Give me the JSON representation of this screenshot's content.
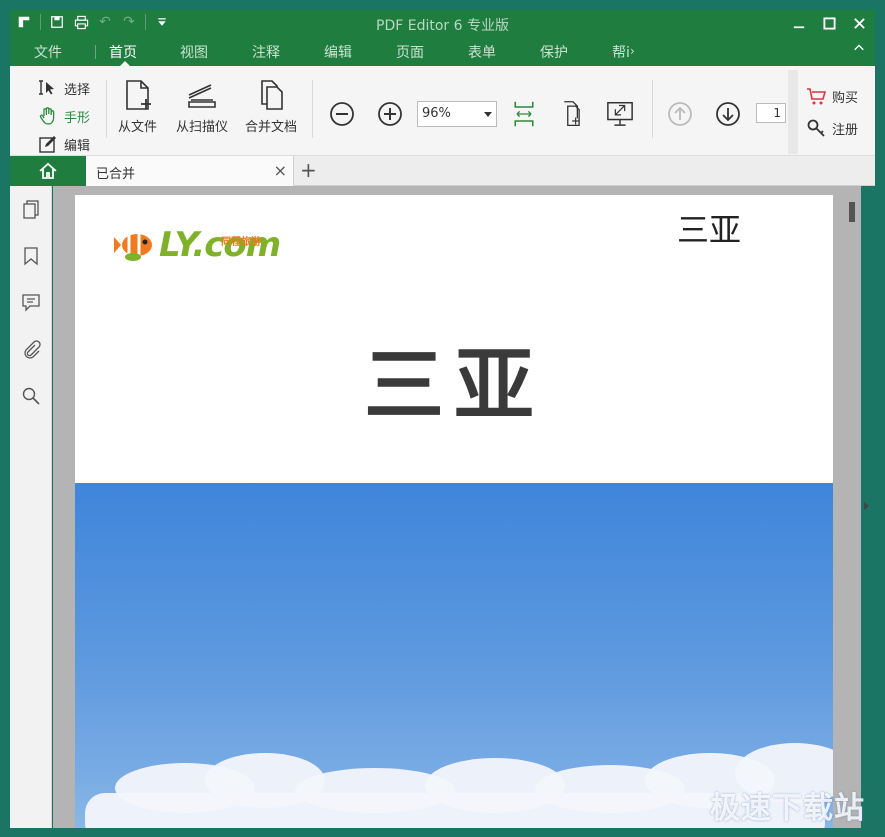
{
  "app": {
    "title": "PDF Editor 6 专业版"
  },
  "menu": {
    "tabs": [
      "文件",
      "首页",
      "视图",
      "注释",
      "编辑",
      "页面",
      "表单",
      "保护",
      "帮i"
    ],
    "active": "首页"
  },
  "ribbon": {
    "modes": [
      {
        "label": "选择",
        "icon": "select-cursor-icon"
      },
      {
        "label": "手形",
        "icon": "hand-icon"
      },
      {
        "label": "编辑",
        "icon": "edit-icon"
      }
    ],
    "from_file": "从文件",
    "from_scanner": "从扫描仪",
    "merge_docs": "合并文档",
    "zoom_value": "96%",
    "page_number": "1",
    "buy": "购买",
    "register": "注册"
  },
  "docbar": {
    "tab_name": "已合并",
    "close": "×",
    "add": "+"
  },
  "document": {
    "logo_text": "LY.com",
    "logo_sub": "同程旅游",
    "corner_title": "三亚",
    "main_title": "三亚"
  },
  "watermark": "极速下载站",
  "colors": {
    "brand_green": "#1e7d3f",
    "accent_green": "#2f8a3e",
    "sky_blue": "#4a8ddc"
  }
}
